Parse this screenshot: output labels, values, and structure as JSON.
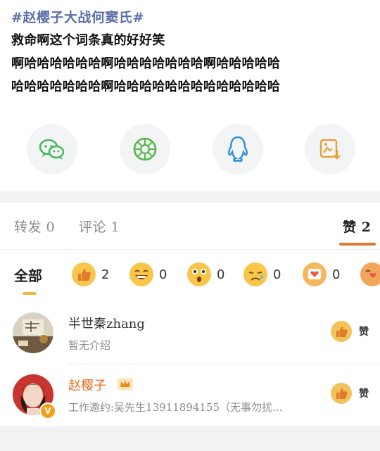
{
  "post": {
    "hashtag": "#赵樱子大战何窦氏#",
    "lines": [
      "救命啊这个词条真的好好笑",
      "啊哈哈哈哈哈哈啊哈哈哈哈哈哈哈啊哈哈哈哈哈",
      "哈哈哈哈哈哈哈啊哈哈哈哈哈哈哈哈哈哈哈哈哈"
    ]
  },
  "share": [
    {
      "icon": "wechat-icon",
      "color": "#48b85c"
    },
    {
      "icon": "moments-icon",
      "color": "#54b848"
    },
    {
      "icon": "qq-icon",
      "color": "#2f8fd8"
    },
    {
      "icon": "save-image-icon",
      "color": "#e6a23c"
    }
  ],
  "tabs": {
    "repost": "转发 0",
    "comments": "评论 1",
    "likes": "赞 2",
    "accent": "#e2782b"
  },
  "reactions": {
    "all_label": "全部",
    "items": [
      {
        "icon": "thumbs-up-icon",
        "count": "2"
      },
      {
        "icon": "laugh-icon",
        "count": "0"
      },
      {
        "icon": "surprised-icon",
        "count": "0"
      },
      {
        "icon": "sad-icon",
        "count": "0"
      },
      {
        "icon": "heart-icon",
        "count": "0"
      }
    ]
  },
  "users": [
    {
      "name": "半世秦zhang",
      "desc": "暂无介绍",
      "like_label": "赞"
    },
    {
      "name": "赵樱子",
      "desc": "工作邀约:吴先生13911894155（无事勿扰...",
      "like_label": "赞",
      "name_color": "#e86b1f"
    }
  ]
}
